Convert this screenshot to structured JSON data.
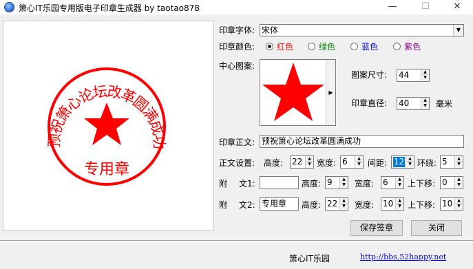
{
  "window": {
    "title": "箫心IT乐园专用版电子印章生成器 by taotao878",
    "minimize": "—",
    "maximize": "☐",
    "close": "✕"
  },
  "stamp": {
    "ring_text": "预祝箫心论坛改革圆满成功",
    "center_text": "专用章",
    "color": "#ff0000"
  },
  "form": {
    "font_label": "印章字体:",
    "font_value": "宋体",
    "color_label": "印章颜色:",
    "colors": [
      {
        "label": "红色",
        "hex": "#ff0000",
        "selected": true
      },
      {
        "label": "绿色",
        "hex": "#008000",
        "selected": false
      },
      {
        "label": "蓝色",
        "hex": "#0000ff",
        "selected": false
      },
      {
        "label": "紫色",
        "hex": "#800080",
        "selected": false
      }
    ],
    "pattern_label": "中心图案:",
    "pattern_icon": "star-icon",
    "pattern_size_label": "图案尺寸:",
    "pattern_size": "44",
    "diameter_label": "印章直径:",
    "diameter": "40",
    "diameter_unit": "毫米",
    "main_text_label": "印章正文:",
    "main_text": "预祝箫心论坛改革圆满成功",
    "text_settings_label": "正文设置:",
    "height_label": "高度:",
    "height": "22",
    "width_label": "宽度:",
    "width": "6",
    "spacing_label": "间距:",
    "spacing": "12",
    "wrap_label": "环绕:",
    "wrap": "5",
    "extra1_label_a": "附",
    "extra1_label_b": "文1:",
    "extra1_text": "",
    "extra1_height": "9",
    "extra1_width": "6",
    "extra1_offset_label": "上下移:",
    "extra1_offset": "0",
    "extra2_label_a": "附",
    "extra2_label_b": "文2:",
    "extra2_text": "专用章",
    "extra2_height": "22",
    "extra2_width": "10",
    "extra2_offset": "10"
  },
  "buttons": {
    "save": "保存签章",
    "close": "关闭"
  },
  "status": {
    "name": "箫心IT乐园",
    "link": "http://bbs.52happy.net"
  }
}
